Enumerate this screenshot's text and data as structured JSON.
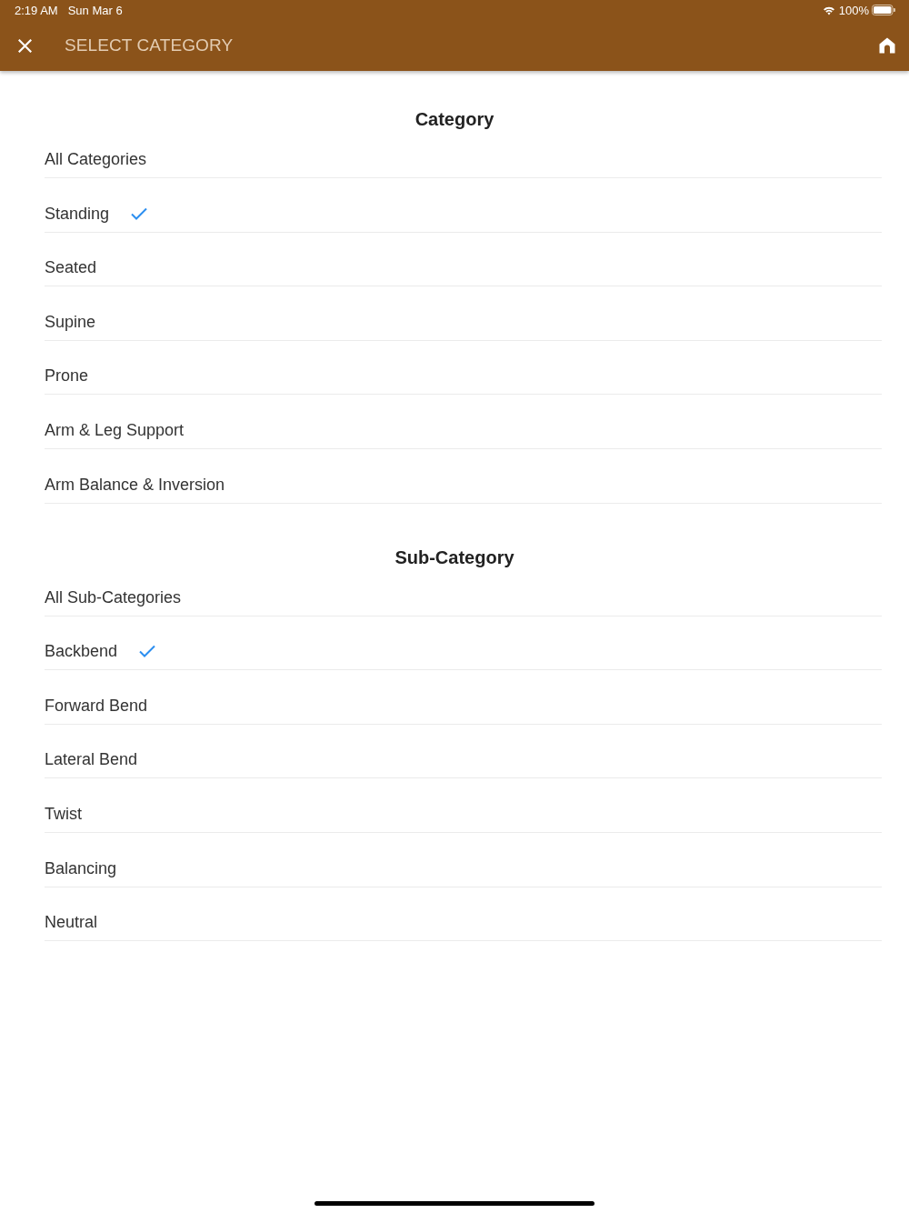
{
  "status_bar": {
    "time": "2:19 AM",
    "date": "Sun Mar 6",
    "battery": "100%"
  },
  "header": {
    "title": "SELECT CATEGORY"
  },
  "sections": [
    {
      "title": "Category",
      "items": [
        {
          "label": "All Categories",
          "selected": false
        },
        {
          "label": "Standing",
          "selected": true
        },
        {
          "label": "Seated",
          "selected": false
        },
        {
          "label": "Supine",
          "selected": false
        },
        {
          "label": "Prone",
          "selected": false
        },
        {
          "label": "Arm & Leg Support",
          "selected": false
        },
        {
          "label": "Arm Balance & Inversion",
          "selected": false
        }
      ]
    },
    {
      "title": "Sub-Category",
      "items": [
        {
          "label": "All Sub-Categories",
          "selected": false
        },
        {
          "label": "Backbend",
          "selected": true
        },
        {
          "label": "Forward Bend",
          "selected": false
        },
        {
          "label": "Lateral Bend",
          "selected": false
        },
        {
          "label": "Twist",
          "selected": false
        },
        {
          "label": "Balancing",
          "selected": false
        },
        {
          "label": "Neutral",
          "selected": false
        }
      ]
    }
  ]
}
